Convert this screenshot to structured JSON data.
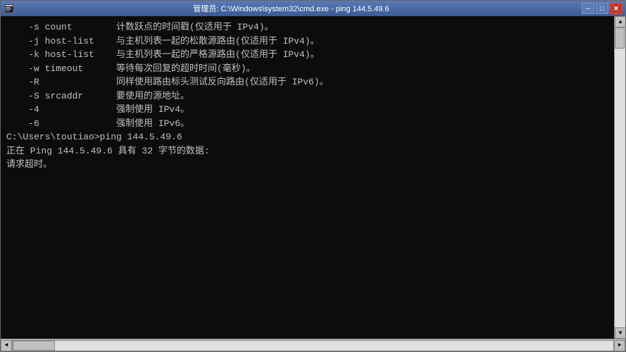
{
  "window": {
    "title": "管理员: C:\\Windows\\system32\\cmd.exe - ping  144.5.49.6",
    "icon": "cmd"
  },
  "titlebar": {
    "minimize_label": "─",
    "maximize_label": "□",
    "close_label": "✕"
  },
  "terminal": {
    "lines": [
      "    -s count        计数跃点的时间戳(仅适用于 IPv4)。",
      "    -j host-list    与主机列表一起的松散源路由(仅适用于 IPv4)。",
      "    -k host-list    与主机列表一起的严格源路由(仅适用于 IPv4)。",
      "    -w timeout      等待每次回复的超时时间(毫秒)。",
      "    -R              同样使用路由标头测试反向路由(仅适用于 IPv6)。",
      "    -S srcaddr      要使用的源地址。",
      "    -4              强制使用 IPv4。",
      "    -6              强制使用 IPv6。",
      "",
      "",
      "C:\\Users\\toutiao>ping 144.5.49.6",
      "",
      "正在 Ping 144.5.49.6 具有 32 字节的数据:",
      "请求超时。"
    ]
  },
  "scrollbar": {
    "up_arrow": "▲",
    "down_arrow": "▼",
    "left_arrow": "◄",
    "right_arrow": "►"
  }
}
